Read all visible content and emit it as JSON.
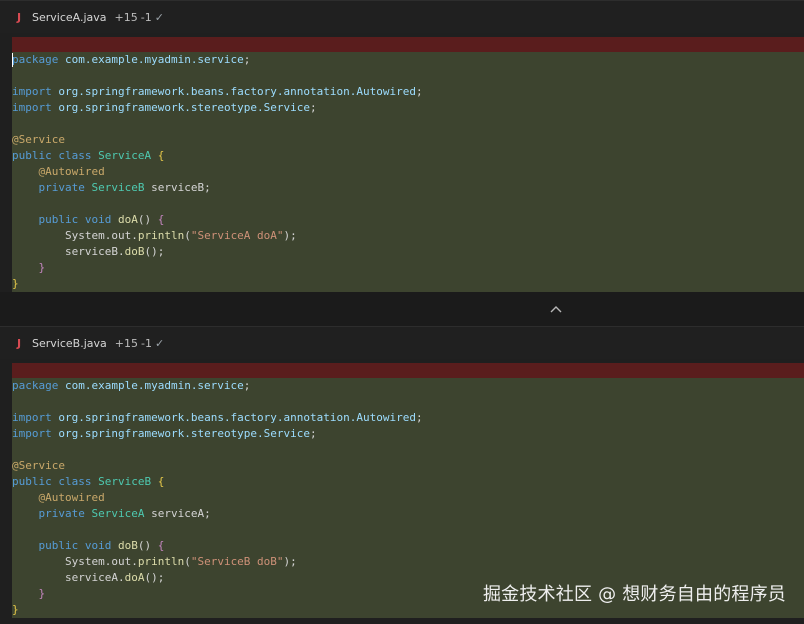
{
  "diffs": [
    {
      "file_name": "ServiceA.java",
      "added": "+15",
      "removed": "-1",
      "lines": [
        {
          "tokens": [
            {
              "t": "package",
              "c": "kw"
            },
            {
              "t": " ",
              "c": "punct"
            },
            {
              "t": "com.example.myadmin.service",
              "c": "ns"
            },
            {
              "t": ";",
              "c": "punct"
            }
          ]
        },
        {
          "tokens": []
        },
        {
          "tokens": [
            {
              "t": "import",
              "c": "kw"
            },
            {
              "t": " ",
              "c": "punct"
            },
            {
              "t": "org.springframework.beans.factory.annotation.Autowired",
              "c": "ns"
            },
            {
              "t": ";",
              "c": "punct"
            }
          ]
        },
        {
          "tokens": [
            {
              "t": "import",
              "c": "kw"
            },
            {
              "t": " ",
              "c": "punct"
            },
            {
              "t": "org.springframework.stereotype.Service",
              "c": "ns"
            },
            {
              "t": ";",
              "c": "punct"
            }
          ]
        },
        {
          "tokens": []
        },
        {
          "tokens": [
            {
              "t": "@Service",
              "c": "anno"
            }
          ]
        },
        {
          "tokens": [
            {
              "t": "public class ",
              "c": "kw"
            },
            {
              "t": "ServiceA",
              "c": "cls"
            },
            {
              "t": " ",
              "c": "punct"
            },
            {
              "t": "{",
              "c": "brace"
            }
          ]
        },
        {
          "tokens": [
            {
              "t": "    ",
              "c": "punct"
            },
            {
              "t": "@Autowired",
              "c": "anno"
            }
          ]
        },
        {
          "tokens": [
            {
              "t": "    ",
              "c": "punct"
            },
            {
              "t": "private ",
              "c": "kw"
            },
            {
              "t": "ServiceB",
              "c": "cls"
            },
            {
              "t": " serviceB;",
              "c": "var"
            }
          ]
        },
        {
          "tokens": []
        },
        {
          "tokens": [
            {
              "t": "    ",
              "c": "punct"
            },
            {
              "t": "public void ",
              "c": "kw"
            },
            {
              "t": "doA",
              "c": "method"
            },
            {
              "t": "() ",
              "c": "punct"
            },
            {
              "t": "{",
              "c": "bracepurple"
            }
          ]
        },
        {
          "tokens": [
            {
              "t": "        ",
              "c": "punct"
            },
            {
              "t": "System.out.",
              "c": "var"
            },
            {
              "t": "println",
              "c": "method"
            },
            {
              "t": "(",
              "c": "punct"
            },
            {
              "t": "\"ServiceA doA\"",
              "c": "str"
            },
            {
              "t": ");",
              "c": "punct"
            }
          ]
        },
        {
          "tokens": [
            {
              "t": "        ",
              "c": "punct"
            },
            {
              "t": "serviceB.",
              "c": "var"
            },
            {
              "t": "doB",
              "c": "method"
            },
            {
              "t": "();",
              "c": "punct"
            }
          ]
        },
        {
          "tokens": [
            {
              "t": "    ",
              "c": "punct"
            },
            {
              "t": "}",
              "c": "bracepurple"
            }
          ]
        },
        {
          "tokens": [
            {
              "t": "}",
              "c": "brace"
            }
          ]
        }
      ]
    },
    {
      "file_name": "ServiceB.java",
      "added": "+15",
      "removed": "-1",
      "lines": [
        {
          "tokens": [
            {
              "t": "package",
              "c": "kw"
            },
            {
              "t": " ",
              "c": "punct"
            },
            {
              "t": "com.example.myadmin.service",
              "c": "ns"
            },
            {
              "t": ";",
              "c": "punct"
            }
          ]
        },
        {
          "tokens": []
        },
        {
          "tokens": [
            {
              "t": "import",
              "c": "kw"
            },
            {
              "t": " ",
              "c": "punct"
            },
            {
              "t": "org.springframework.beans.factory.annotation.Autowired",
              "c": "ns"
            },
            {
              "t": ";",
              "c": "punct"
            }
          ]
        },
        {
          "tokens": [
            {
              "t": "import",
              "c": "kw"
            },
            {
              "t": " ",
              "c": "punct"
            },
            {
              "t": "org.springframework.stereotype.Service",
              "c": "ns"
            },
            {
              "t": ";",
              "c": "punct"
            }
          ]
        },
        {
          "tokens": []
        },
        {
          "tokens": [
            {
              "t": "@Service",
              "c": "anno"
            }
          ]
        },
        {
          "tokens": [
            {
              "t": "public class ",
              "c": "kw"
            },
            {
              "t": "ServiceB",
              "c": "cls"
            },
            {
              "t": " ",
              "c": "punct"
            },
            {
              "t": "{",
              "c": "brace"
            }
          ]
        },
        {
          "tokens": [
            {
              "t": "    ",
              "c": "punct"
            },
            {
              "t": "@Autowired",
              "c": "anno"
            }
          ]
        },
        {
          "tokens": [
            {
              "t": "    ",
              "c": "punct"
            },
            {
              "t": "private ",
              "c": "kw"
            },
            {
              "t": "ServiceA",
              "c": "cls"
            },
            {
              "t": " serviceA;",
              "c": "var"
            }
          ]
        },
        {
          "tokens": []
        },
        {
          "tokens": [
            {
              "t": "    ",
              "c": "punct"
            },
            {
              "t": "public void ",
              "c": "kw"
            },
            {
              "t": "doB",
              "c": "method"
            },
            {
              "t": "() ",
              "c": "punct"
            },
            {
              "t": "{",
              "c": "bracepurple"
            }
          ]
        },
        {
          "tokens": [
            {
              "t": "        ",
              "c": "punct"
            },
            {
              "t": "System.out.",
              "c": "var"
            },
            {
              "t": "println",
              "c": "method"
            },
            {
              "t": "(",
              "c": "punct"
            },
            {
              "t": "\"ServiceB doB\"",
              "c": "str"
            },
            {
              "t": ");",
              "c": "punct"
            }
          ]
        },
        {
          "tokens": [
            {
              "t": "        ",
              "c": "punct"
            },
            {
              "t": "serviceA.",
              "c": "var"
            },
            {
              "t": "doA",
              "c": "method"
            },
            {
              "t": "();",
              "c": "punct"
            }
          ]
        },
        {
          "tokens": [
            {
              "t": "    ",
              "c": "punct"
            },
            {
              "t": "}",
              "c": "bracepurple"
            }
          ]
        },
        {
          "tokens": [
            {
              "t": "}",
              "c": "brace"
            }
          ]
        }
      ]
    }
  ],
  "collapse_icon": "chevron-up-icon",
  "watermark": "掘金技术社区 @ 想财务自由的程序员",
  "file_badge": "J",
  "check_glyph": "✓",
  "colors": {
    "background": "#1b1b1b",
    "added_block": "#3d442f",
    "deleted_bar": "#5a1d1d"
  }
}
